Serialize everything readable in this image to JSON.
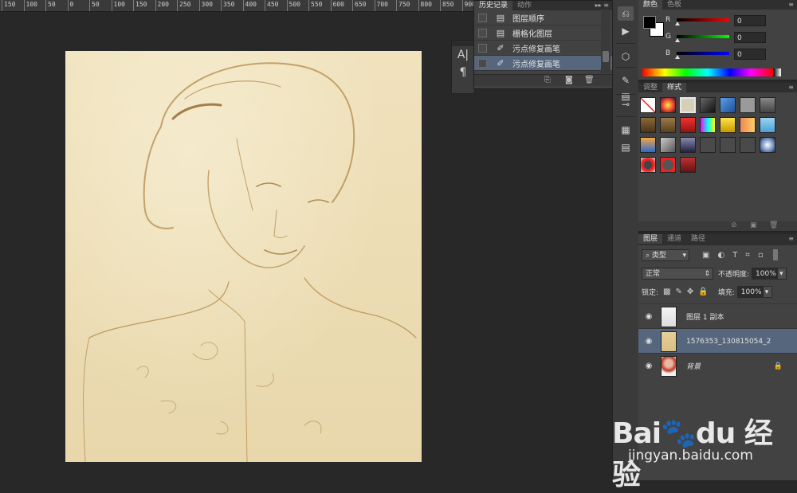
{
  "ruler": {
    "labels": [
      "150",
      "100",
      "50",
      "0",
      "50",
      "100",
      "150",
      "200",
      "250",
      "300",
      "350",
      "400",
      "450",
      "500",
      "550",
      "600",
      "650",
      "700",
      "750",
      "800",
      "850",
      "900"
    ]
  },
  "mini_panel": {
    "glyph_top": "A|",
    "glyph_bottom": "¶"
  },
  "history": {
    "tabs": [
      "历史记录",
      "动作"
    ],
    "items": [
      {
        "label": "图层顺序",
        "icon": "document-icon"
      },
      {
        "label": "栅格化图层",
        "icon": "document-icon"
      },
      {
        "label": "污点修复画笔",
        "icon": "bandage-icon"
      },
      {
        "label": "污点修复画笔",
        "icon": "bandage-icon",
        "selected": true
      }
    ]
  },
  "color": {
    "tabs": [
      "颜色",
      "色板"
    ],
    "channels": [
      {
        "label": "R",
        "value": "0"
      },
      {
        "label": "G",
        "value": "0"
      },
      {
        "label": "B",
        "value": "0"
      }
    ],
    "foreground": "#000000",
    "background": "#ffffff"
  },
  "styles": {
    "tabs": [
      "调整",
      "样式"
    ]
  },
  "layers": {
    "tabs": [
      "图层",
      "通道",
      "路径"
    ],
    "filter_kind": "类型",
    "blend_mode": "正常",
    "opacity_label": "不透明度:",
    "opacity_value": "100%",
    "lock_label": "锁定:",
    "fill_label": "填充:",
    "fill_value": "100%",
    "items": [
      {
        "name": "图层 1 副本",
        "selected": false,
        "locked": false
      },
      {
        "name": "1576353_130815054_2",
        "selected": true,
        "locked": false
      },
      {
        "name": "背景",
        "selected": false,
        "locked": true
      }
    ]
  },
  "watermark": {
    "brand_left": "Bai",
    "brand_mid": "du",
    "brand_cn": "经验",
    "url": "jingyan.baidu.com"
  }
}
